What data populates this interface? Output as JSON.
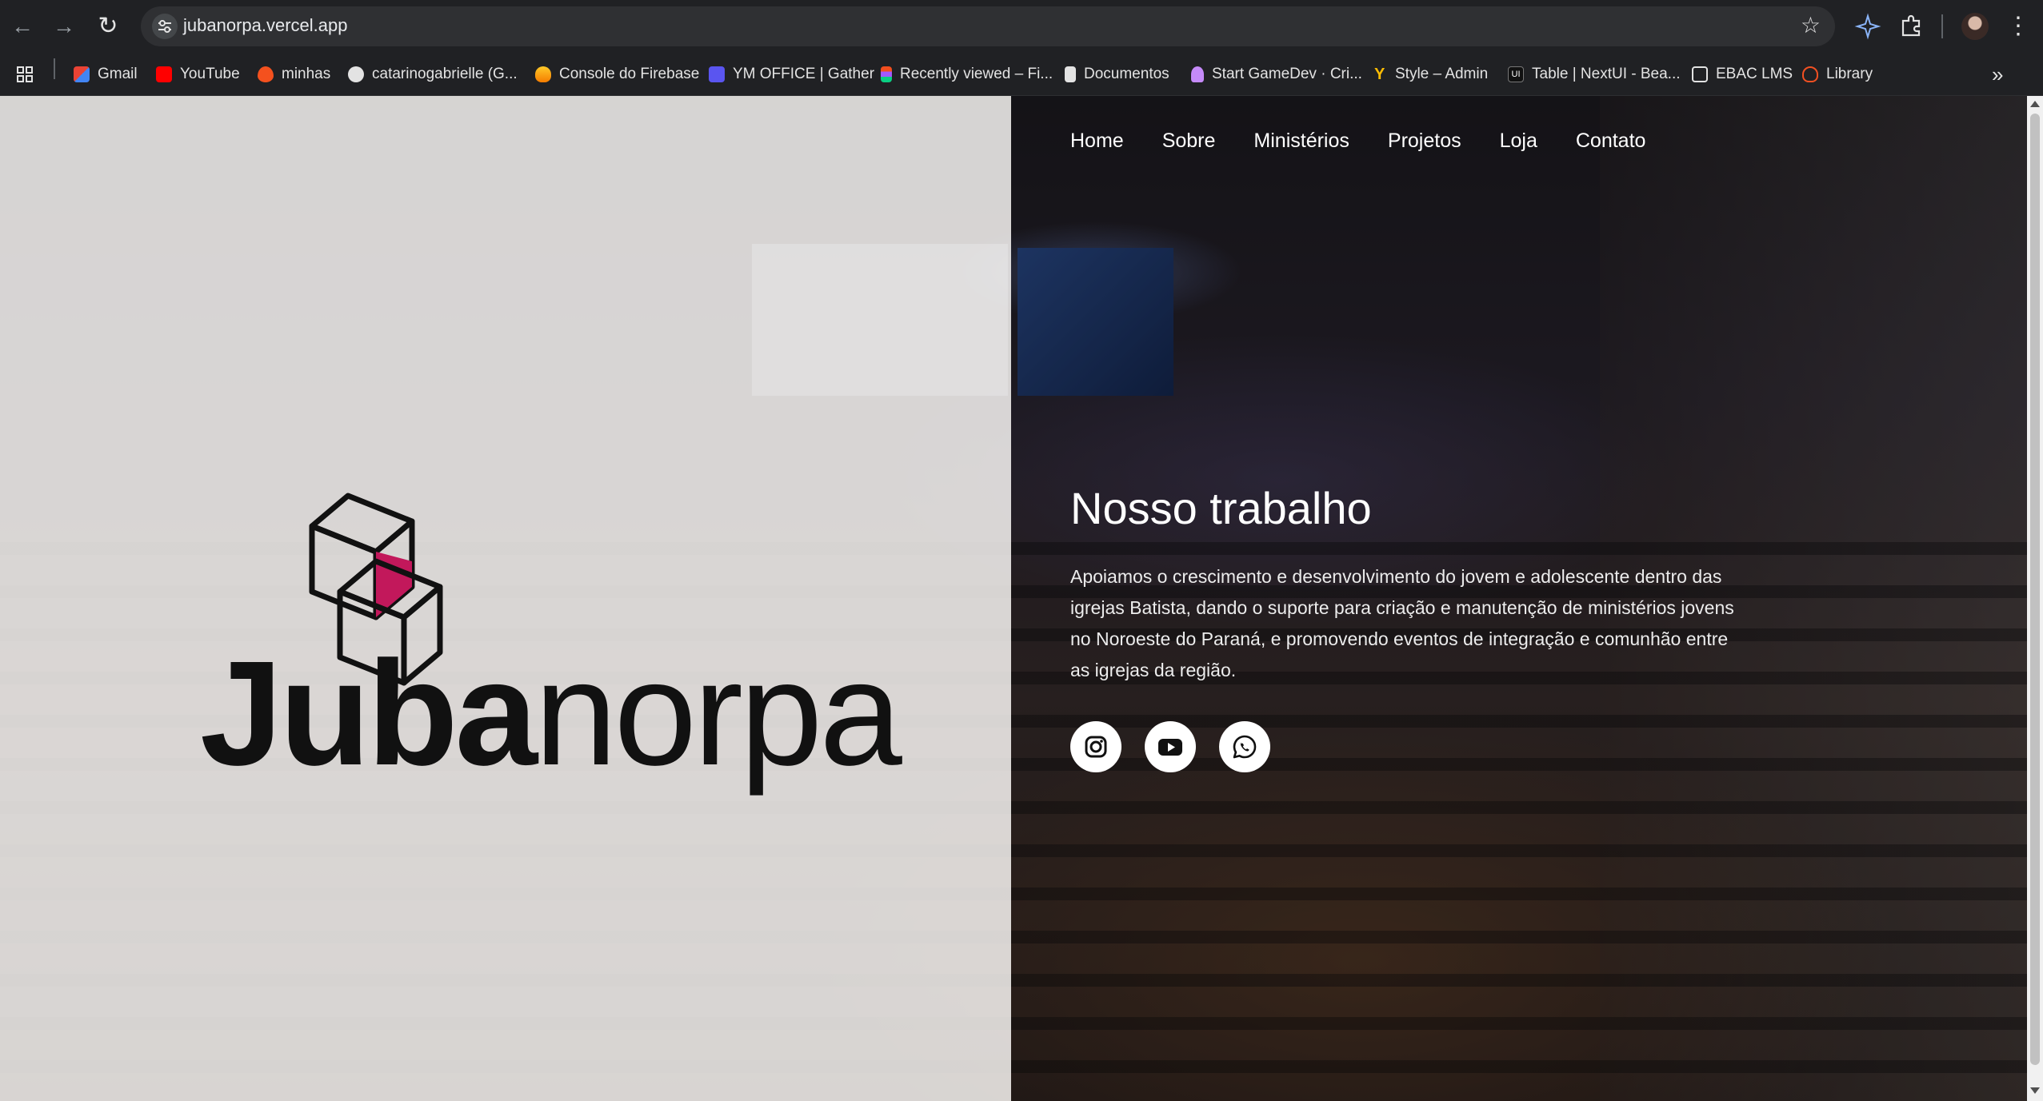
{
  "browser": {
    "url": "jubanorpa.vercel.app",
    "bookmarks": [
      {
        "label": "Gmail",
        "icon": "gmail-icon",
        "color": "#ea4335"
      },
      {
        "label": "YouTube",
        "icon": "youtube-icon",
        "color": "#ff0000"
      },
      {
        "label": "minhas",
        "icon": "flame-icon",
        "color": "#f4511e"
      },
      {
        "label": "catarinogabrielle (G...",
        "icon": "github-icon",
        "color": "#e3e3e3"
      },
      {
        "label": "Console do Firebase",
        "icon": "firebase-icon",
        "color": "#ffa000"
      },
      {
        "label": "YM OFFICE | Gather",
        "icon": "gather-icon",
        "color": "#5a55f0"
      },
      {
        "label": "Recently viewed – Fi...",
        "icon": "figma-icon",
        "color": "#f24e1e"
      },
      {
        "label": "Documentos",
        "icon": "docs-icon",
        "color": "#e3e3e3"
      },
      {
        "label": "Start GameDev · Cri...",
        "icon": "gamedev-icon",
        "color": "#c58af9"
      },
      {
        "label": "Style – Admin",
        "icon": "style-icon",
        "color": "#fbbc04"
      },
      {
        "label": "Table | NextUI - Bea...",
        "icon": "nextui-icon",
        "color": "#111111"
      },
      {
        "label": "EBAC LMS",
        "icon": "ebac-icon",
        "color": "#e3e3e3"
      },
      {
        "label": "Library",
        "icon": "library-icon",
        "color": "#f25022"
      }
    ],
    "overflow_label": "»"
  },
  "site": {
    "logo": {
      "bold": "Juba",
      "light": "norpa",
      "accent_color": "#c2185b"
    },
    "nav": [
      "Home",
      "Sobre",
      "Ministérios",
      "Projetos",
      "Loja",
      "Contato"
    ],
    "hero": {
      "title": "Nosso trabalho",
      "text": "Apoiamos o crescimento e desenvolvimento do jovem e adolescente dentro das igrejas Batista, dando o suporte para criação e manutenção de ministérios jovens no Noroeste do Paraná, e promovendo eventos de integração e comunhão entre as igrejas da região."
    },
    "social": [
      {
        "icon": "instagram-icon"
      },
      {
        "icon": "youtube-icon"
      },
      {
        "icon": "whatsapp-icon"
      }
    ]
  }
}
